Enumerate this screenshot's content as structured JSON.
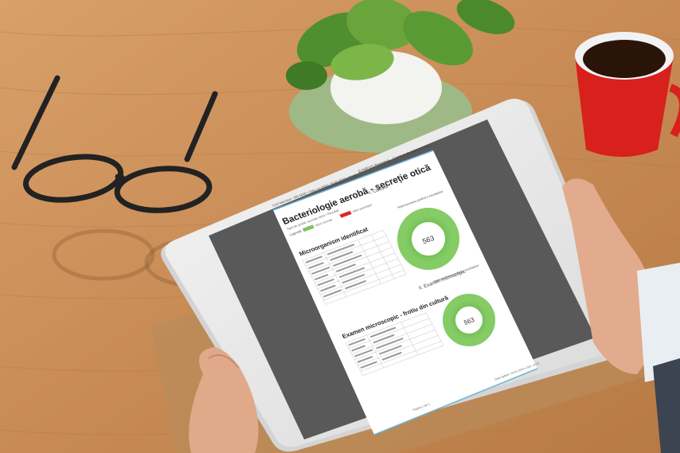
{
  "document": {
    "header_left": "Cod laborator: 185 5605 • Data recoltării: 20.01.2023 • Pagina 1",
    "header_right": "SYNEVO Romania - Centrul de laboratoare",
    "title": "Bacteriologie aerobă - secreție otică",
    "subtitle": "Tipul de probă: secreție otică • Rezultat",
    "legend_label": "Legendă",
    "legend_normal": "Valori normale",
    "legend_abnormal": "Valori patologice",
    "section1_title": "Microorganism identificat",
    "section2_title": "Examen microscopic - frotiu din cultură",
    "right_section1": "I. Cultura",
    "right_section2": "II. Examen microscopic",
    "chart_caption_1": "Reprezentarea grafică a rezultatelor",
    "chart_caption_2": "Reprezentarea grafică a rezultatelor",
    "donut_label_1": "563",
    "donut_label_2": "563",
    "footer_left": "Pagina 1 din 1",
    "footer_right": "Data tipăririi: 20.01.2023 • Ora: 14:22"
  },
  "colors": {
    "table": "#c98a52",
    "donut": "#7cc45e",
    "legend_normal": "#7cc45e",
    "legend_abnormal": "#d9262e",
    "mug": "#d8201c"
  }
}
